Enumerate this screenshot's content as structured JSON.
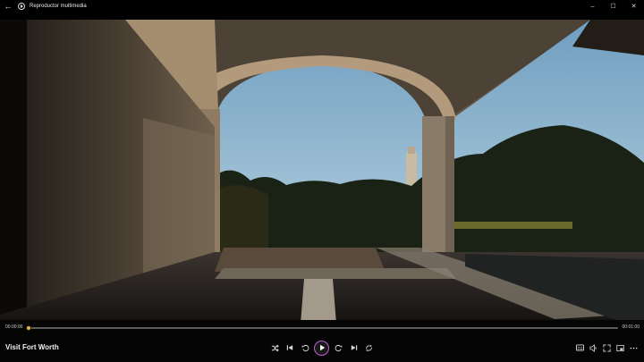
{
  "window": {
    "title": "Reproductor multimedia",
    "back_icon": "back-arrow-icon",
    "app_icon": "media-player-icon",
    "minimize_glyph": "–",
    "maximize_glyph": "☐",
    "close_glyph": "✕"
  },
  "player": {
    "video_title": "Visit Fort Worth",
    "current_time": "00:00:00",
    "total_time": "00:01:00",
    "progress": 0.0,
    "accent_color": "#d4a14a",
    "play_ring_color": "#c55bd6",
    "center_controls": [
      "shuffle-icon",
      "previous-icon",
      "rewind-10-icon",
      "play-icon",
      "forward-30-icon",
      "next-icon",
      "repeat-icon"
    ],
    "right_controls": [
      "subtitles-icon",
      "volume-icon",
      "fullscreen-icon",
      "mini-player-icon",
      "more-options-icon"
    ]
  }
}
